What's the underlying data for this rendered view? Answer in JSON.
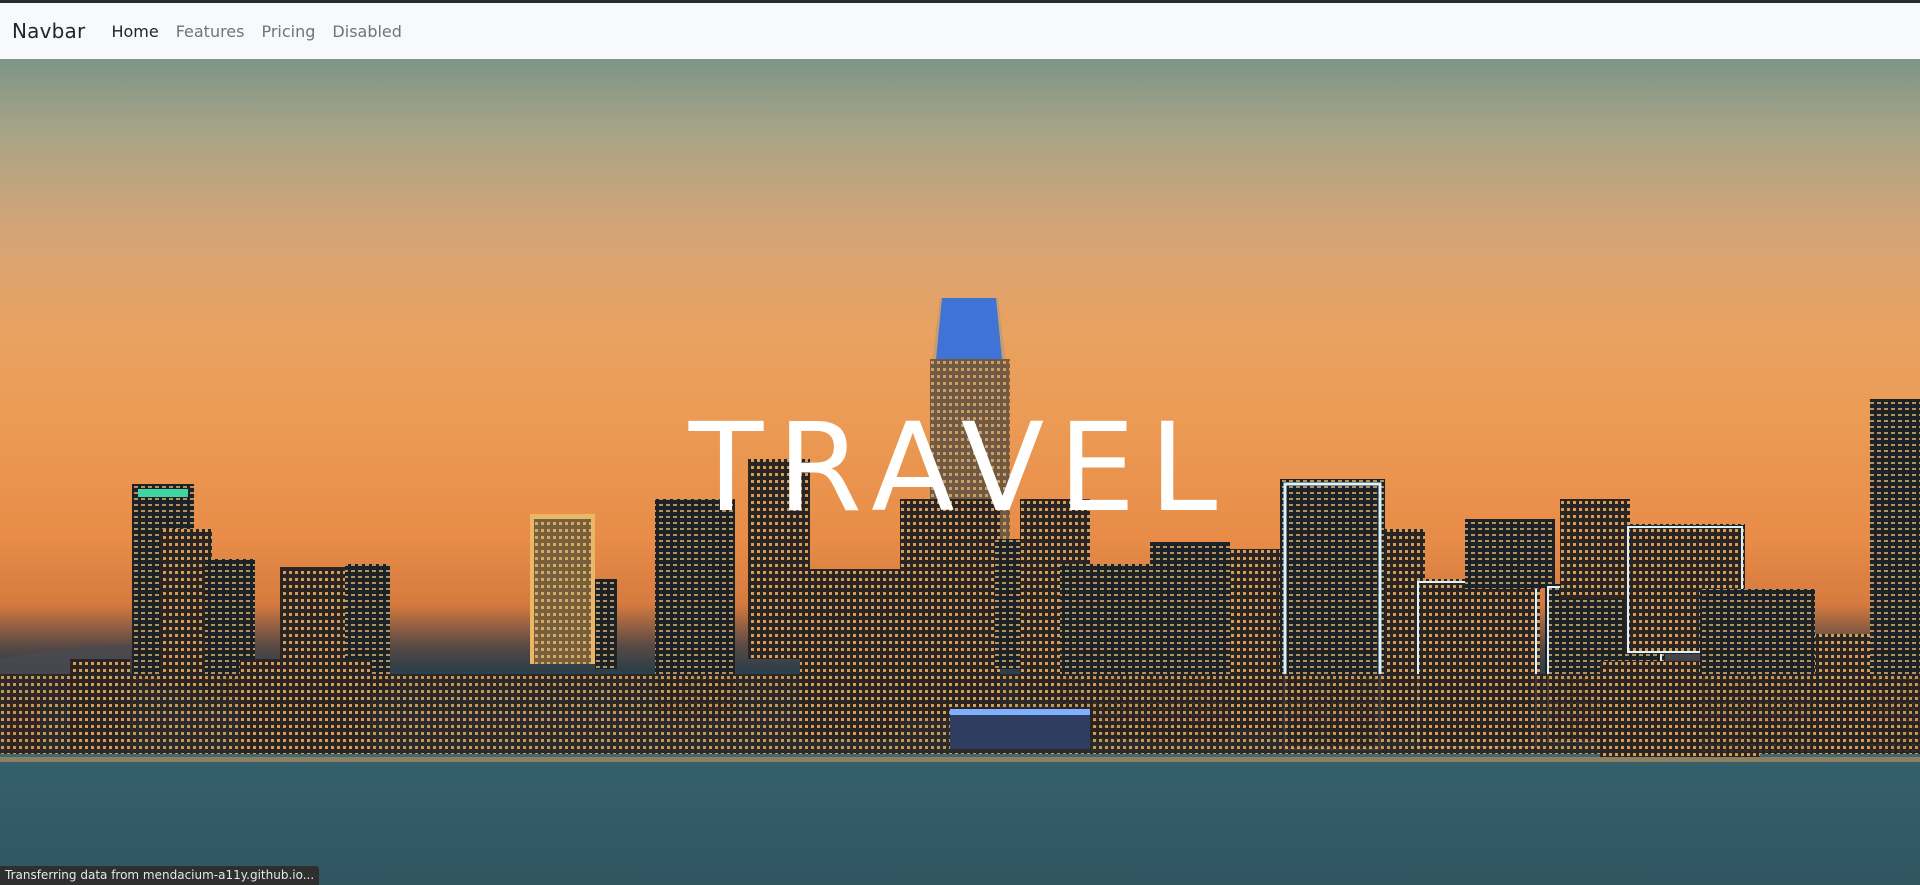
{
  "navbar": {
    "brand": "Navbar",
    "links": [
      {
        "label": "Home",
        "state": "active"
      },
      {
        "label": "Features",
        "state": "normal"
      },
      {
        "label": "Pricing",
        "state": "normal"
      },
      {
        "label": "Disabled",
        "state": "disabled"
      }
    ]
  },
  "hero": {
    "title": "TRAVEL",
    "background": "city-skyline-at-sunset-photo"
  },
  "status_bar": {
    "text": "Transferring data from mendacium-a11y.github.io..."
  },
  "colors": {
    "navbar_bg": "#f8f9fa",
    "text_dark": "#212529",
    "text_muted": "#6c757d",
    "hero_title": "#ffffff"
  }
}
